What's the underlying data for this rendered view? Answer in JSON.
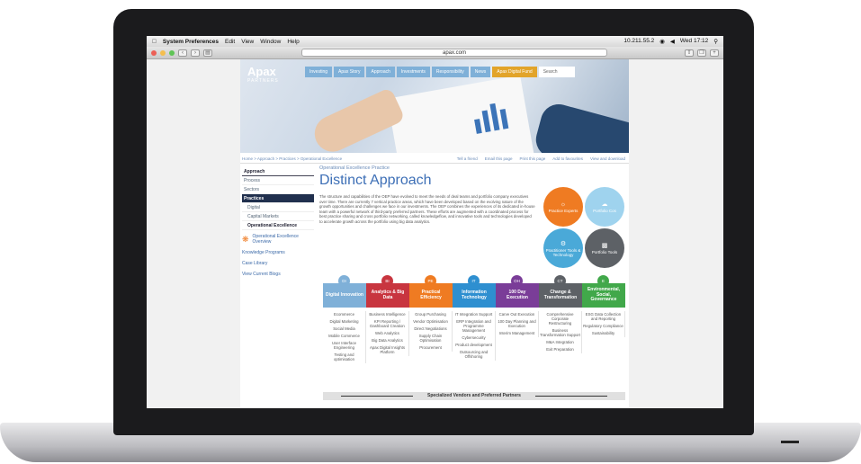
{
  "menubar": {
    "apple": "",
    "app": "System Preferences",
    "items": [
      "Edit",
      "View",
      "Window",
      "Help"
    ],
    "ip": "10.211.55.2",
    "clock": "Wed 17:12"
  },
  "browser": {
    "url": "apax.com"
  },
  "site": {
    "logo": "Apax",
    "logo_sub": "PARTNERS",
    "nav": [
      "Investing",
      "Apax Story",
      "Approach",
      "Investments",
      "Responsibility",
      "News",
      "Apax Digital Fund",
      "Search"
    ],
    "crumbs": "Home > Approach > Practices > Operational Excellence",
    "tools": [
      "Tell a friend",
      "Email this page",
      "Print this page",
      "Add to favourites",
      "View and download"
    ]
  },
  "sidebar": {
    "items": [
      "Approach",
      "Process",
      "Sectors",
      "Practices",
      "Digital",
      "Capital Markets",
      "Operational Excellence"
    ],
    "external": "Operational Excellence Overview",
    "links": [
      "Knowledge Programs",
      "Case Library",
      "View Current Blogs"
    ]
  },
  "main": {
    "kicker": "Operational Excellence Practice",
    "title": "Distinct Approach",
    "body": "The structure and capabilities of the OEP have evolved to meet the needs of deal teams and portfolio company executives over time. There are currently 7 vertical practice areas, which have been developed based on the evolving nature of the growth opportunities and challenges we face in our investments. The OEP combines the experiences of its dedicated in-house team with a powerful network of third-party preferred partners. These efforts are augmented with a coordinated process for best practice sharing and cross portfolio networking, called knowledgeflow, and innovative tools and technologies developed to accelerate growth across the portfolio using big data analytics."
  },
  "circles": [
    {
      "label": "Practice Experts",
      "icon": "bulb-icon",
      "color": "#ef7b22"
    },
    {
      "label": "Portfolio Cos",
      "icon": "cloud-icon",
      "color": "#9fd3ee"
    },
    {
      "label": "Practitioner Tools & Technology",
      "icon": "tools-icon",
      "color": "#4aa9d8"
    },
    {
      "label": "Portfolio Tools",
      "icon": "chart-icon",
      "color": "#5d6166"
    }
  ],
  "practices": [
    {
      "badge": "DI",
      "title": "Digital Innovation",
      "color": "#7fb0d8",
      "items": [
        "Ecommerce",
        "Digital Marketing",
        "Social Media",
        "Mobile Commerce",
        "User Interface Engineering",
        "Testing and optimisation"
      ]
    },
    {
      "badge": "BI",
      "title": "Analytics & Big Data",
      "color": "#c8353f",
      "items": [
        "Business Intelligence",
        "KPI Reporting / Dashboard Creation",
        "Web Analytics",
        "Big Data Analytics",
        "Apax Digital Insights Platform"
      ]
    },
    {
      "badge": "PE",
      "title": "Practical Efficiency",
      "color": "#ef7b22",
      "items": [
        "Group Purchasing",
        "Vendor Optimisation",
        "Direct Negotiations",
        "Supply Chain Optimisation",
        "Procurement"
      ]
    },
    {
      "badge": "IT",
      "title": "Information Technology",
      "color": "#2e8fd0",
      "items": [
        "IT Integration Support",
        "ERP Integration and Programme Management",
        "Cybersecurity",
        "Product development",
        "Outsourcing and Offshoring"
      ]
    },
    {
      "badge": "OH",
      "title": "100 Day Execution",
      "color": "#7a3d98",
      "items": [
        "Carve Out Execution",
        "100 Day Planning and Execution",
        "Interim Management"
      ]
    },
    {
      "badge": "CT",
      "title": "Change & Transformation",
      "color": "#5d6166",
      "items": [
        "Comprehensive Corporate Restructuring",
        "Business Transformation Support",
        "M&A Integration",
        "Exit Preparation"
      ]
    },
    {
      "badge": "E",
      "title": "Environmental, Social, Governance",
      "color": "#41a84a",
      "items": [
        "ESG Data Collection and Reporting",
        "Regulatory Compliance",
        "Sustainability"
      ]
    }
  ],
  "partners": "Specialized Vendors and Preferred Partners"
}
